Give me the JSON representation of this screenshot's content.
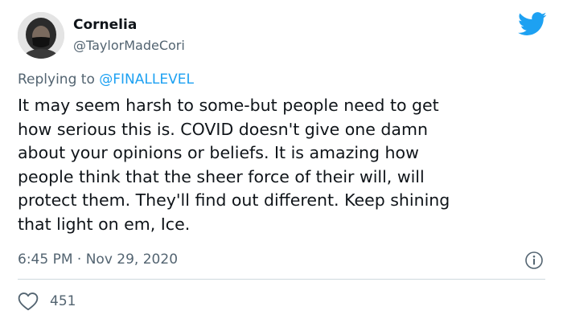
{
  "user": {
    "name": "Cornelia",
    "handle": "@TaylorMadeCori"
  },
  "reply": {
    "prefix": "Replying to",
    "handle": "@FINALLEVEL"
  },
  "tweet": {
    "text": "It may seem harsh to some-but people need to get\nhow serious this is. COVID doesn't give one damn\nabout your opinions or beliefs. It is amazing how\npeople think that the sheer force of their will, will\nprotect them. They'll find out different.  Keep shining\nthat light on em, Ice.",
    "time": "6:45 PM",
    "separator": "·",
    "date": "Nov 29, 2020"
  },
  "engagement": {
    "likes": "451"
  },
  "colors": {
    "brand": "#1da1f2",
    "muted": "#536471",
    "divider": "#cfd9de"
  },
  "icons": [
    "twitter-bird-icon",
    "info-icon",
    "heart-icon"
  ]
}
